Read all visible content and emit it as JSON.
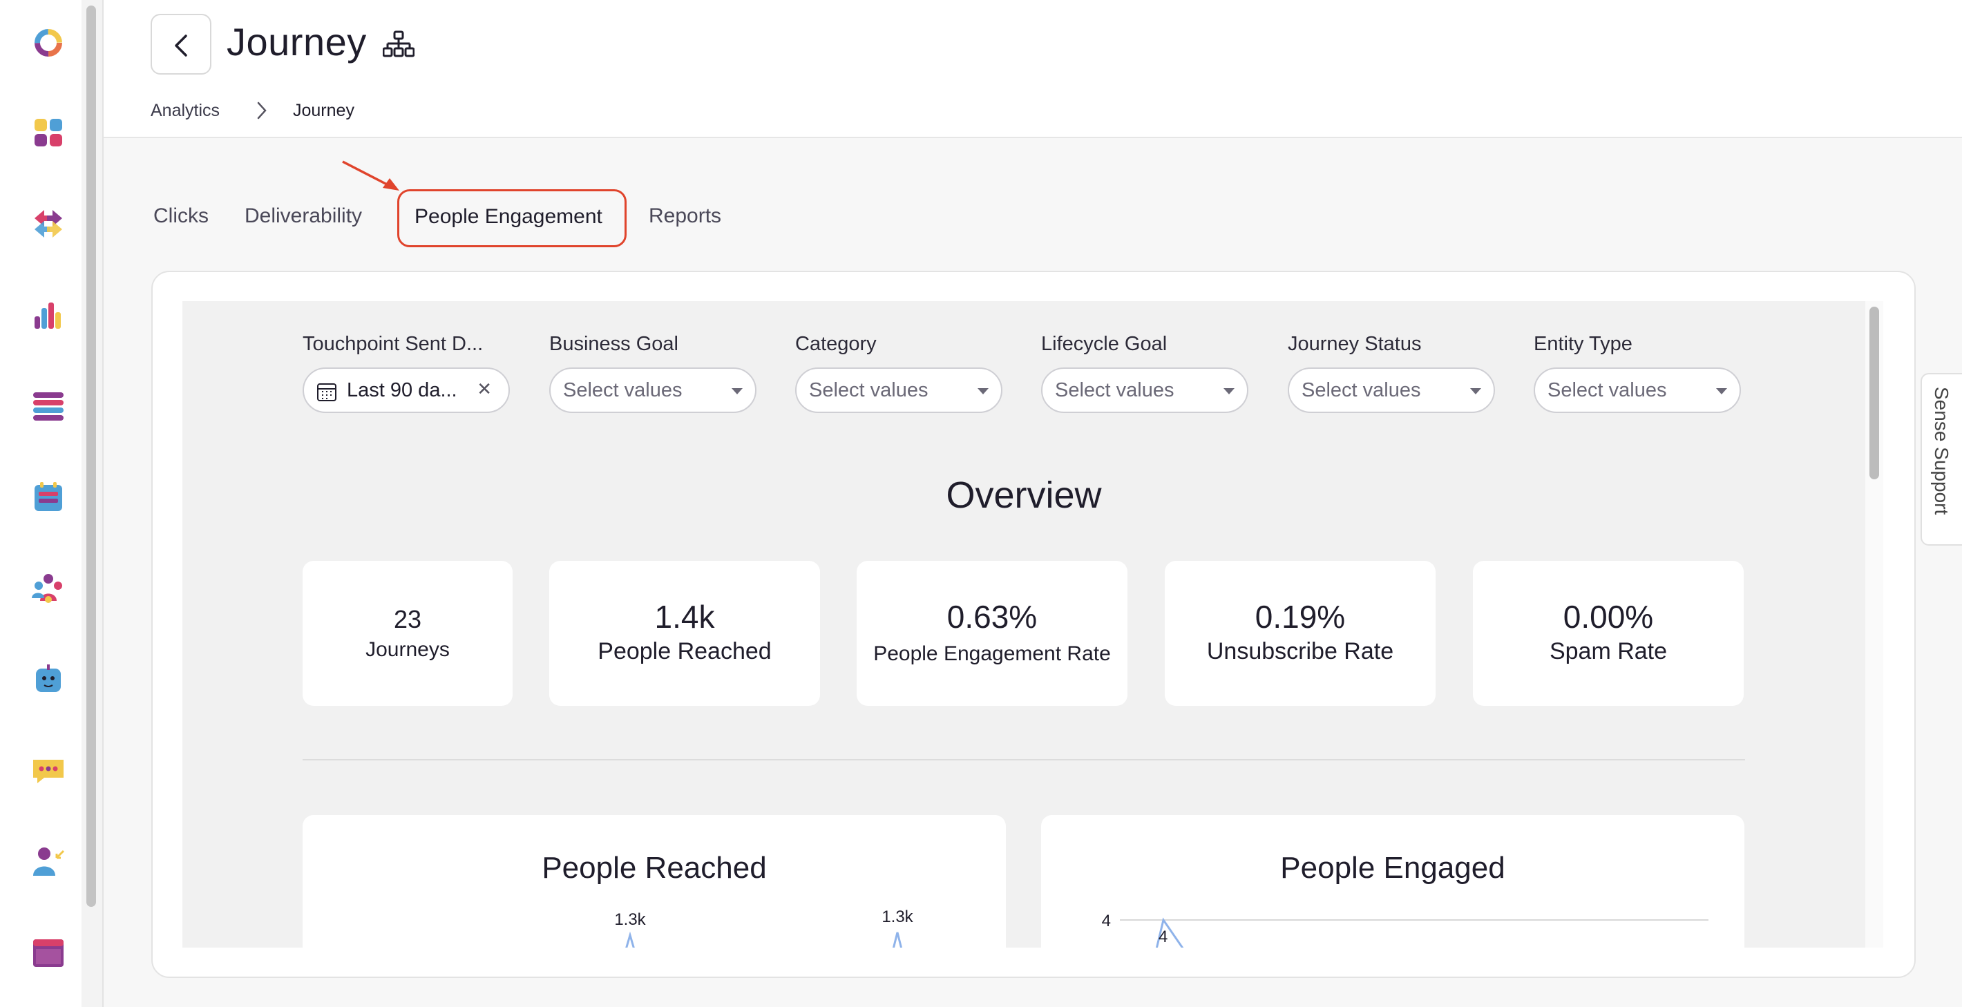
{
  "header": {
    "title": "Journey"
  },
  "breadcrumb": {
    "parent": "Analytics",
    "current": "Journey"
  },
  "tabs": [
    {
      "label": "Clicks"
    },
    {
      "label": "Deliverability"
    },
    {
      "label": "People Engagement",
      "active": true
    },
    {
      "label": "Reports"
    }
  ],
  "filters": {
    "touchpoint": {
      "label": "Touchpoint Sent D...",
      "value": "Last 90 da..."
    },
    "business_goal": {
      "label": "Business Goal",
      "placeholder": "Select values"
    },
    "category": {
      "label": "Category",
      "placeholder": "Select values"
    },
    "lifecycle_goal": {
      "label": "Lifecycle Goal",
      "placeholder": "Select values"
    },
    "journey_status": {
      "label": "Journey Status",
      "placeholder": "Select values"
    },
    "entity_type": {
      "label": "Entity Type",
      "placeholder": "Select values"
    }
  },
  "overview": {
    "title": "Overview",
    "kpis": [
      {
        "value": "23",
        "label": "Journeys"
      },
      {
        "value": "1.4k",
        "label": "People Reached"
      },
      {
        "value": "0.63%",
        "label": "People Engagement Rate"
      },
      {
        "value": "0.19%",
        "label": "Unsubscribe Rate"
      },
      {
        "value": "0.00%",
        "label": "Spam Rate"
      }
    ]
  },
  "charts": {
    "people_reached": {
      "title": "People Reached"
    },
    "people_engaged": {
      "title": "People Engaged"
    }
  },
  "chart_data": [
    {
      "type": "line",
      "title": "People Reached",
      "data_labels": [
        "1.3k",
        "1.3k"
      ],
      "values": [
        1300,
        1300
      ]
    },
    {
      "type": "line",
      "title": "People Engaged",
      "yticks": [
        "4"
      ],
      "data_labels": [
        "4"
      ],
      "values": [
        4
      ]
    }
  ],
  "support": {
    "label": "Sense Support"
  },
  "colors": {
    "accent_outline": "#e0442c",
    "chart_line": "#8fb3ea"
  }
}
